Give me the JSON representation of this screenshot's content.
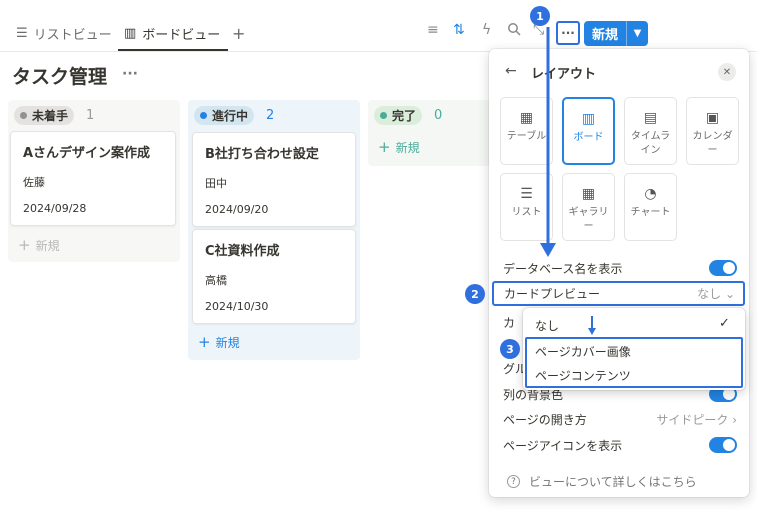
{
  "tabs": [
    {
      "icon": "list-icon",
      "label": "リストビュー"
    },
    {
      "icon": "board-icon",
      "label": "ボードビュー"
    }
  ],
  "toolbar": {
    "new_label": "新規"
  },
  "page": {
    "title": "タスク管理"
  },
  "board": {
    "columns": [
      {
        "status": "未着手",
        "count": "1",
        "dot_color": "#91918e",
        "pill_bg": "#e3e2e0",
        "col_bg": "#f7f7f5",
        "cards": [
          {
            "title": "Aさんデザイン案作成",
            "person": "佐藤",
            "date": "2024/09/28"
          }
        ],
        "add_label": "新規"
      },
      {
        "status": "進行中",
        "count": "2",
        "dot_color": "#2383e2",
        "pill_bg": "#d3e5ef",
        "col_bg": "#eef5fa",
        "cards": [
          {
            "title": "B社打ち合わせ設定",
            "person": "田中",
            "date": "2024/09/20"
          },
          {
            "title": "C社資料作成",
            "person": "高橋",
            "date": "2024/10/30"
          }
        ],
        "add_label": "新規"
      },
      {
        "status": "完了",
        "count": "0",
        "dot_color": "#4dab9a",
        "pill_bg": "#dbeddb",
        "col_bg": "#f4f7f4",
        "cards": [],
        "add_label": "新規"
      }
    ]
  },
  "layout_panel": {
    "title": "レイアウト",
    "layouts": [
      {
        "label": "テーブル",
        "icon": "table-icon"
      },
      {
        "label": "ボード",
        "icon": "board-icon"
      },
      {
        "label": "タイムライン",
        "icon": "timeline-icon"
      },
      {
        "label": "カレンダー",
        "icon": "calendar-icon"
      },
      {
        "label": "リスト",
        "icon": "list-icon"
      },
      {
        "label": "ギャラリー",
        "icon": "gallery-icon"
      },
      {
        "label": "チャート",
        "icon": "chart-icon"
      }
    ],
    "selected_layout": "ボード",
    "settings": {
      "show_db_name": "データベース名を表示",
      "card_preview": "カードプレビュー",
      "card_preview_value": "なし",
      "card_size_partial": "カ",
      "group_partial": "グル",
      "column_bg": "列の背景色",
      "page_open": "ページの開き方",
      "page_open_value": "サイドピーク",
      "show_page_icon": "ページアイコンを表示"
    },
    "help": "ビューについて詳しくはこちら"
  },
  "card_preview_options": [
    "なし",
    "ページカバー画像",
    "ページコンテンツ"
  ],
  "annotations": [
    "1",
    "2",
    "3"
  ],
  "colors": {
    "accent": "#2383e2",
    "annotation": "#2f6fde"
  }
}
